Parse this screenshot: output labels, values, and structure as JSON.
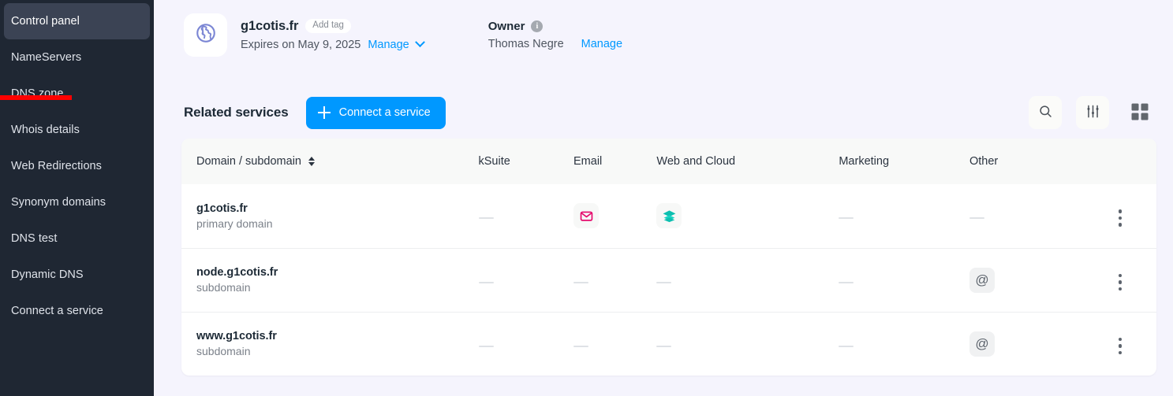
{
  "sidebar": {
    "items": [
      {
        "label": "Control panel",
        "active": true
      },
      {
        "label": "NameServers",
        "active": false
      },
      {
        "label": "DNS zone",
        "active": false
      },
      {
        "label": "Whois details",
        "active": false
      },
      {
        "label": "Web Redirections",
        "active": false
      },
      {
        "label": "Synonym domains",
        "active": false
      },
      {
        "label": "DNS test",
        "active": false
      },
      {
        "label": "Dynamic DNS",
        "active": false
      },
      {
        "label": "Connect a service",
        "active": false
      }
    ],
    "annotation_color": "#fe0000"
  },
  "header": {
    "domain_icon": "globe-icon",
    "domain_name": "g1cotis.fr",
    "add_tag_label": "Add tag",
    "expiry_text": "Expires on May 9, 2025",
    "expiry_manage_label": "Manage",
    "owner_label": "Owner",
    "owner_info_icon": "info-icon",
    "owner_name": "Thomas Negre",
    "owner_manage_label": "Manage",
    "link_color": "#0098ff"
  },
  "toolbar": {
    "section_title": "Related services",
    "connect_button_label": "Connect a service",
    "connect_button_color": "#0098ff",
    "search_icon": "search-icon",
    "filter_icon": "filter-sliders-icon",
    "grid_icon": "grid-view-icon"
  },
  "table": {
    "columns": [
      "Domain / subdomain",
      "kSuite",
      "Email",
      "Web and Cloud",
      "Marketing",
      "Other"
    ],
    "sort_icon": "sort-arrows-icon",
    "rows": [
      {
        "name": "g1cotis.fr",
        "type": "primary domain",
        "ksuite": "none",
        "email": "mail-icon",
        "email_color": "#e5096c",
        "web_cloud": "layers-icon",
        "web_cloud_color": "#0dbfb0",
        "marketing": "none",
        "other": "none",
        "menu_icon": "kebab-menu-icon"
      },
      {
        "name": "node.g1cotis.fr",
        "type": "subdomain",
        "ksuite": "none",
        "email": "none",
        "web_cloud": "none",
        "marketing": "none",
        "other": "at-icon",
        "menu_icon": "kebab-menu-icon"
      },
      {
        "name": "www.g1cotis.fr",
        "type": "subdomain",
        "ksuite": "none",
        "email": "none",
        "web_cloud": "none",
        "marketing": "none",
        "other": "at-icon",
        "menu_icon": "kebab-menu-icon"
      }
    ]
  }
}
